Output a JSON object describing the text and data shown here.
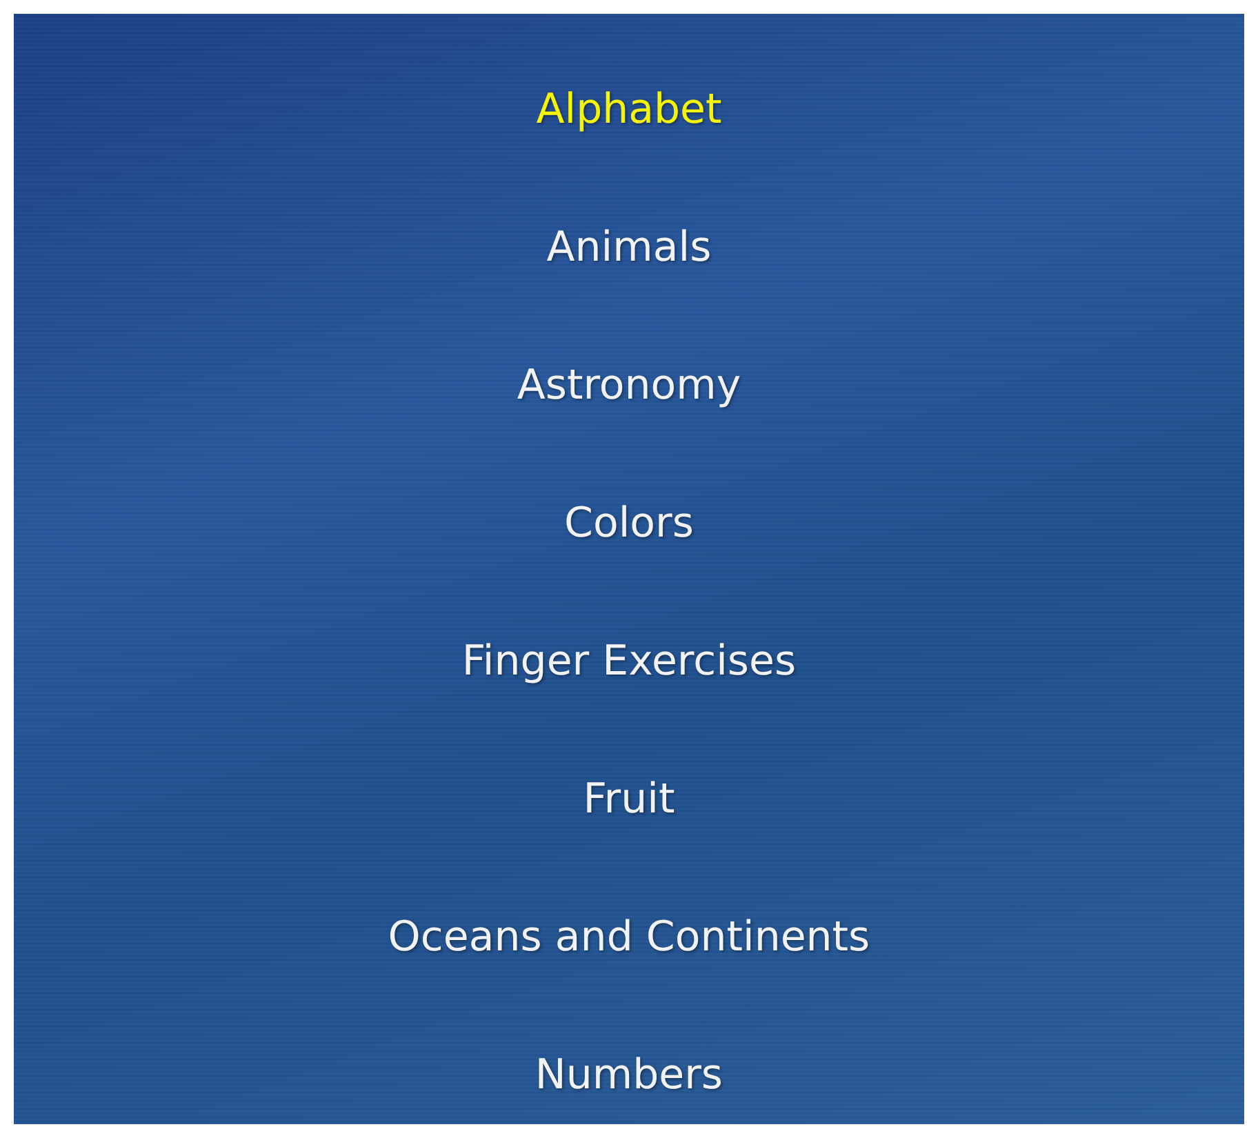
{
  "menu": {
    "items": [
      {
        "label": "Alphabet",
        "selected": true
      },
      {
        "label": "Animals",
        "selected": false
      },
      {
        "label": "Astronomy",
        "selected": false
      },
      {
        "label": "Colors",
        "selected": false
      },
      {
        "label": "Finger Exercises",
        "selected": false
      },
      {
        "label": "Fruit",
        "selected": false
      },
      {
        "label": "Oceans and Continents",
        "selected": false
      },
      {
        "label": "Numbers",
        "selected": false
      }
    ]
  }
}
